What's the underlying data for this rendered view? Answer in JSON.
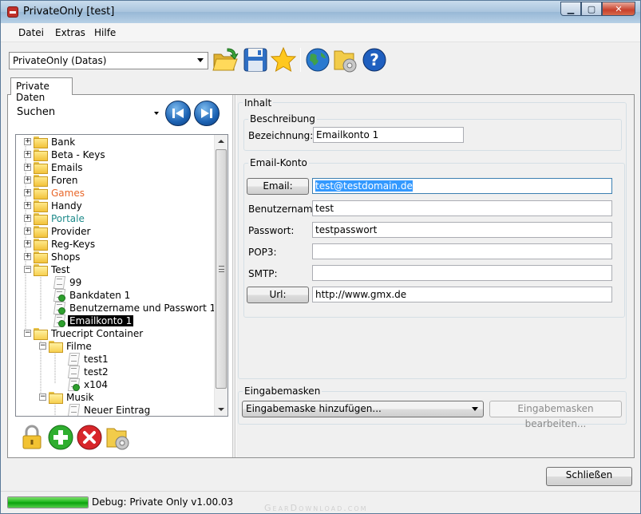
{
  "window": {
    "title": "PrivateOnly [test]"
  },
  "menu": [
    "Datei",
    "Extras",
    "Hilfe"
  ],
  "toolbar": {
    "database_select": "PrivateOnly (Datas)",
    "icons": [
      "open-folder-icon",
      "save-icon",
      "star-icon",
      "globe-icon",
      "folder-settings-icon",
      "help-icon"
    ]
  },
  "tabs": [
    "Private Daten"
  ],
  "left": {
    "search_label": "Suchen",
    "tree": [
      {
        "label": "Bank",
        "type": "folder",
        "level": 0,
        "color": "#000000"
      },
      {
        "label": "Beta - Keys",
        "type": "folder",
        "level": 0,
        "color": "#000000"
      },
      {
        "label": "Emails",
        "type": "folder",
        "level": 0,
        "color": "#000000"
      },
      {
        "label": "Foren",
        "type": "folder",
        "level": 0,
        "color": "#000000"
      },
      {
        "label": "Games",
        "type": "folder",
        "level": 0,
        "color": "#e8672a"
      },
      {
        "label": "Handy",
        "type": "folder",
        "level": 0,
        "color": "#000000"
      },
      {
        "label": "Portale",
        "type": "folder",
        "level": 0,
        "color": "#1d8a8a"
      },
      {
        "label": "Provider",
        "type": "folder",
        "level": 0,
        "color": "#000000"
      },
      {
        "label": "Reg-Keys",
        "type": "folder",
        "level": 0,
        "color": "#000000"
      },
      {
        "label": "Shops",
        "type": "folder",
        "level": 0,
        "color": "#000000"
      },
      {
        "label": "Test",
        "type": "folder-open",
        "level": 0,
        "color": "#000000"
      },
      {
        "label": "99",
        "type": "note",
        "level": 1,
        "color": "#000000"
      },
      {
        "label": "Bankdaten 1",
        "type": "note-ok",
        "level": 1,
        "color": "#000000"
      },
      {
        "label": "Benutzername und Passwort 1",
        "type": "note-ok",
        "level": 1,
        "color": "#000000"
      },
      {
        "label": "Emailkonto 1",
        "type": "note-ok",
        "level": 1,
        "color": "#000000",
        "selected": true
      },
      {
        "label": "Truecript Container",
        "type": "folder-open",
        "level": 0,
        "color": "#000000"
      },
      {
        "label": "Filme",
        "type": "folder-open",
        "level": 1,
        "color": "#000000"
      },
      {
        "label": "test1",
        "type": "note",
        "level": 2,
        "color": "#000000"
      },
      {
        "label": "test2",
        "type": "note",
        "level": 2,
        "color": "#000000"
      },
      {
        "label": "x104",
        "type": "note-ok",
        "level": 2,
        "color": "#000000"
      },
      {
        "label": "Musik",
        "type": "folder-open",
        "level": 1,
        "color": "#000000"
      },
      {
        "label": "Neuer Eintrag",
        "type": "note",
        "level": 2,
        "color": "#000000"
      }
    ]
  },
  "right": {
    "inhalt_label": "Inhalt",
    "beschreibung_label": "Beschreibung",
    "bezeichnung_label": "Bezeichnung:",
    "bezeichnung_value": "Emailkonto 1",
    "email_konto_label": "Email-Konto",
    "email_button": "Email:",
    "email_value": "test@testdomain.de",
    "benutzername_label": "Benutzername:",
    "benutzername_value": "test",
    "passwort_label": "Passwort:",
    "passwort_value": "testpasswort",
    "pop3_label": "POP3:",
    "pop3_value": "",
    "smtp_label": "SMTP:",
    "smtp_value": "",
    "url_button": "Url:",
    "url_value": "http://www.gmx.de",
    "eingabemasken_label": "Eingabemasken",
    "eingabemaske_select": "Eingabemaske hinzufügen...",
    "eingabemasken_edit_button": "Eingabemasken bearbeiten..."
  },
  "footer": {
    "close_button": "Schließen",
    "status_text": "Debug: Private Only v1.00.03",
    "progress": 1.0,
    "watermark": "GearDownload.com"
  }
}
